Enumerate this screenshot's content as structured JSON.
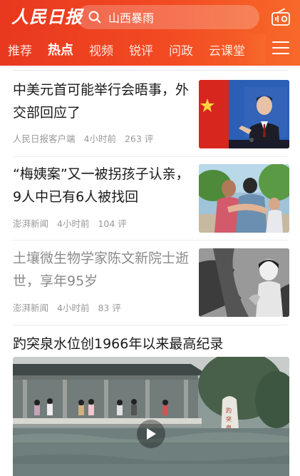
{
  "header": {
    "logo_text": "人民日报",
    "search_text": "山西暴雨",
    "radio_icon": "radio-icon"
  },
  "tabs": [
    {
      "label": "推荐",
      "active": false
    },
    {
      "label": "热点",
      "active": true
    },
    {
      "label": "视频",
      "active": false
    },
    {
      "label": "锐评",
      "active": false
    },
    {
      "label": "问政",
      "active": false
    },
    {
      "label": "云课堂",
      "active": false
    }
  ],
  "feed": [
    {
      "title": "中美元首可能举行会晤事，外交部回应了",
      "source": "人民日报客户端",
      "time": "4小时前",
      "comments": "263 评",
      "read": false,
      "thumb": "foreign-ministry-press-photo"
    },
    {
      "title": "“梅姨案”又一被拐孩子认亲，9人中已有6人被找回",
      "source": "澎湃新闻",
      "time": "4小时前",
      "comments": "104 评",
      "read": false,
      "thumb": "family-reunion-photo"
    },
    {
      "title": "土壤微生物学家陈文新院士逝世，享年95岁",
      "source": "澎湃新闻",
      "time": "4小时前",
      "comments": "83 评",
      "read": true,
      "thumb": "black-white-portrait-photo"
    }
  ],
  "video_item": {
    "title": "趵突泉水位创1966年以来最高纪录",
    "stone_text": "趵突泉"
  },
  "colors": {
    "accent": "#f04523",
    "read_text": "#8a8a8a",
    "meta_text": "#999999"
  }
}
